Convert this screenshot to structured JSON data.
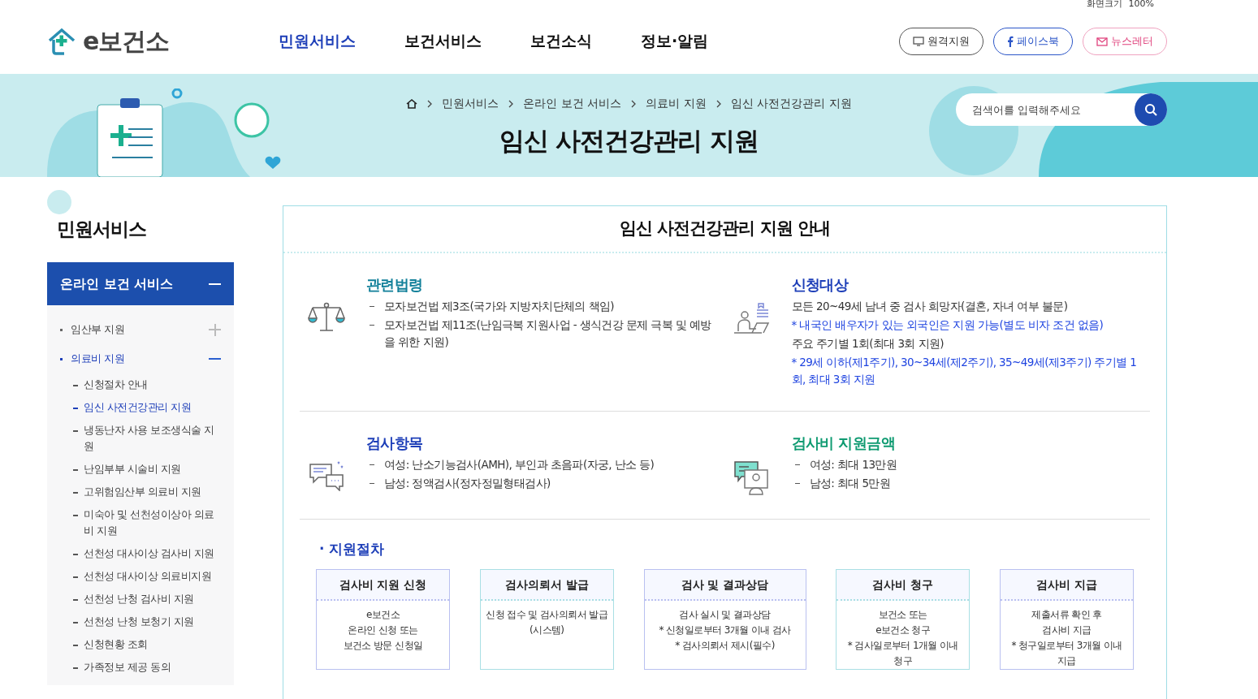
{
  "utility": {
    "labels": [
      "화면크기",
      "100%"
    ]
  },
  "header": {
    "logo": "e보건소",
    "nav": [
      {
        "label": "민원서비스",
        "selected": true
      },
      {
        "label": "보건서비스",
        "selected": false
      },
      {
        "label": "보건소식",
        "selected": false
      },
      {
        "label": "정보·알림",
        "selected": false
      }
    ],
    "buttons": [
      {
        "kind": "remote",
        "label": "원격지원"
      },
      {
        "kind": "facebook",
        "label": "페이스북"
      },
      {
        "kind": "newsletter",
        "label": "뉴스레터"
      }
    ]
  },
  "banner": {
    "breadcrumb": [
      "민원서비스",
      "온라인 보건 서비스",
      "의료비 지원",
      "임신 사전건강관리 지원"
    ],
    "title": "임신 사전건강관리 지원",
    "search": {
      "placeholder": "검색어를 입력해주세요"
    }
  },
  "sidebar": {
    "title": "민원서비스",
    "section": {
      "label": "온라인 보건 서비스",
      "expanded": true
    },
    "items": [
      {
        "label": "임산부 지원",
        "selected": false,
        "expanded": false
      },
      {
        "label": "의료비 지원",
        "selected": true,
        "expanded": true,
        "children": [
          {
            "label": "신청절차 안내",
            "selected": false
          },
          {
            "label": "임신 사전건강관리 지원",
            "selected": true
          },
          {
            "label": "냉동난자 사용 보조생식술 지원",
            "selected": false
          },
          {
            "label": "난임부부 시술비 지원",
            "selected": false
          },
          {
            "label": "고위험임산부 의료비 지원",
            "selected": false
          },
          {
            "label": "미숙아 및 선천성이상아 의료비 지원",
            "selected": false
          },
          {
            "label": "선천성 대사이상 검사비 지원",
            "selected": false
          },
          {
            "label": "선천성 대사이상 의료비지원",
            "selected": false
          },
          {
            "label": "선천성 난청 검사비 지원",
            "selected": false
          },
          {
            "label": "선천성 난청 보청기 지원",
            "selected": false
          },
          {
            "label": "신청현황 조회",
            "selected": false
          },
          {
            "label": "가족정보 제공 동의",
            "selected": false
          }
        ]
      }
    ]
  },
  "content": {
    "title": "임신 사전건강관리 지원 안내",
    "sections": [
      {
        "kind": "law",
        "heading": "관련법령",
        "color": "#12809a",
        "lines": [
          {
            "kind": "dash",
            "text": "모자보건법 제3조(국가와 지방자치단체의 책임)"
          },
          {
            "kind": "dash",
            "text": "모자보건법 제11조(난임극복 지원사업 - 생식건강 문제 극복 및 예방을 위한 지원)"
          }
        ]
      },
      {
        "kind": "target",
        "heading": "신청대상",
        "color": "#1e3fb8",
        "lines": [
          {
            "kind": "plain",
            "text": "모든 20~49세 남녀 중 검사 희망자(결혼, 자녀 여부 불문)"
          },
          {
            "kind": "note",
            "text": "* 내국인 배우자가 있는 외국인은 지원 가능(별도 비자 조건 없음)"
          },
          {
            "kind": "plain",
            "text": "주요 주기별 1회(최대 3회 지원)"
          },
          {
            "kind": "note",
            "text": "* 29세 이하(제1주기), 30~34세(제2주기), 35~49세(제3주기) 주기별 1회, 최대 3회 지원"
          }
        ]
      },
      {
        "kind": "tests",
        "heading": "검사항목",
        "color": "#1e3fb8",
        "lines": [
          {
            "kind": "dash",
            "text": "여성: 난소기능검사(AMH), 부인과 초음파(자궁, 난소 등)"
          },
          {
            "kind": "dash",
            "text": "남성: 정액검사(정자정밀형태검사)"
          }
        ]
      },
      {
        "kind": "amount",
        "heading": "검사비 지원금액",
        "color": "#109b72",
        "lines": [
          {
            "kind": "dash",
            "text": "여성: 최대 13만원"
          },
          {
            "kind": "dash",
            "text": "남성: 최대 5만원"
          }
        ]
      }
    ],
    "procedure": {
      "heading": "· 지원절차",
      "steps": [
        {
          "title": "검사비 지원 신청",
          "color": "#b9c0f0",
          "lines": [
            "e보건소",
            "온라인 신청 또는",
            "보건소 방문 신청일"
          ]
        },
        {
          "title": "검사의뢰서 발급",
          "color": "#a9dfe4",
          "lines": [
            "신청 접수 및 검사의뢰서 발급",
            "(시스템)"
          ]
        },
        {
          "title": "검사 및 결과상담",
          "color": "#b9c0f0",
          "lines": [
            "검사 실시 및 결과상담",
            "* 신청일로부터 3개월 이내 검사",
            "* 검사의뢰서 제시(필수)"
          ]
        },
        {
          "title": "검사비 청구",
          "color": "#a9dfe4",
          "lines": [
            "보건소 또는",
            "e보건소 청구",
            "* 검사일로부터 1개월 이내",
            "청구"
          ]
        },
        {
          "title": "검사비 지급",
          "color": "#b9c0f0",
          "lines": [
            "제출서류 확인 후",
            "검사비 지급",
            "* 청구일로부터 3개월 이내",
            "지급"
          ]
        }
      ]
    }
  }
}
